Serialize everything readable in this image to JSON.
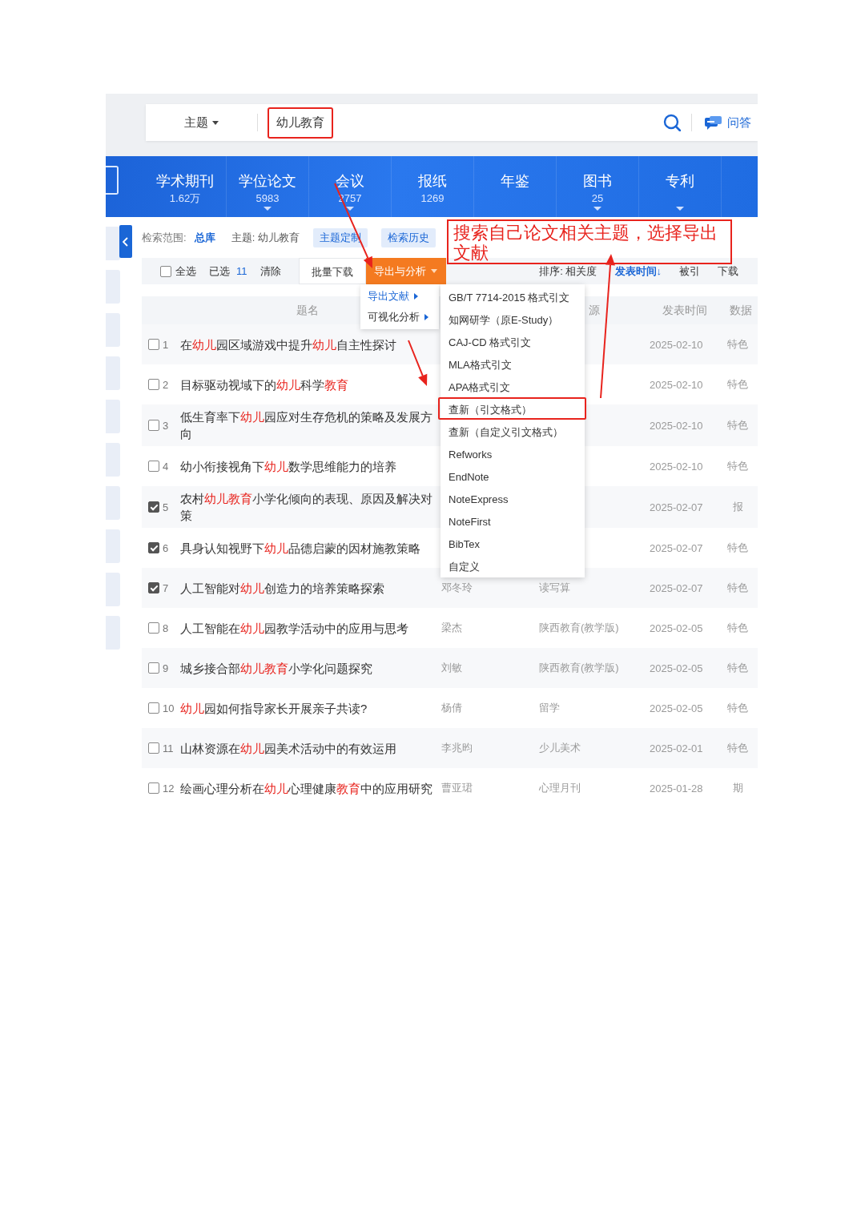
{
  "search": {
    "field_selector": "主题",
    "query": "幼儿教育",
    "query_marked": true,
    "qa_label": "问答"
  },
  "nav_tabs": [
    {
      "label": "学术期刊",
      "count": "1.62万",
      "expandable": false
    },
    {
      "label": "学位论文",
      "count": "5983",
      "expandable": true
    },
    {
      "label": "会议",
      "count": "2757",
      "expandable": true
    },
    {
      "label": "报纸",
      "count": "1269",
      "expandable": false
    },
    {
      "label": "年鉴",
      "expandable": false
    },
    {
      "label": "图书",
      "count": "25",
      "expandable": true
    },
    {
      "label": "专利",
      "expandable": true
    }
  ],
  "scope": {
    "label": "检索范围:",
    "value": "总库",
    "topic": "主题: 幼儿教育",
    "buttons": [
      "主题定制",
      "检索历史"
    ]
  },
  "toolbar": {
    "select_all": {
      "label": "全选",
      "checked": false
    },
    "selected_label": "已选",
    "selected_count": "11",
    "clear": "清除",
    "download": "批量下载",
    "export": "导出与分析",
    "sort_label": "排序: 相关度",
    "sort_options": [
      {
        "label": "发表时间↓",
        "selected": true
      },
      {
        "label": "被引",
        "selected": false
      },
      {
        "label": "下载",
        "selected": false
      }
    ]
  },
  "export_menu": [
    {
      "label": "导出文献",
      "selected": true
    },
    {
      "label": "可视化分析",
      "selected": false
    }
  ],
  "format_menu": [
    {
      "label": "GB/T 7714-2015 格式引文",
      "marked": false
    },
    {
      "label": "知网研学（原E-Study）",
      "marked": false
    },
    {
      "label": "CAJ-CD 格式引文",
      "marked": false
    },
    {
      "label": "MLA格式引文",
      "marked": false
    },
    {
      "label": "APA格式引文",
      "marked": false
    },
    {
      "label": "查新（引文格式）",
      "marked": true
    },
    {
      "label": "查新（自定义引文格式）",
      "marked": false
    },
    {
      "label": "Refworks",
      "marked": false
    },
    {
      "label": "EndNote",
      "marked": false
    },
    {
      "label": "NoteExpress",
      "marked": false
    },
    {
      "label": "NoteFirst",
      "marked": false
    },
    {
      "label": "BibTex",
      "marked": false
    },
    {
      "label": "自定义",
      "marked": false
    }
  ],
  "annotation": {
    "text": "搜索自己论文相关主题，选择导出文献"
  },
  "table": {
    "columns": [
      "题名",
      "源",
      "发表时间",
      "数据"
    ],
    "rows": [
      {
        "number": "1",
        "checked": false,
        "title": [
          {
            "text": "在",
            "highlight": false
          },
          {
            "text": "幼儿",
            "highlight": true
          },
          {
            "text": "园区域游戏中提升",
            "highlight": false
          },
          {
            "text": "幼儿",
            "highlight": true
          },
          {
            "text": "自主性探讨",
            "highlight": false
          }
        ],
        "date": "2025-02-10",
        "database": "特色"
      },
      {
        "number": "2",
        "checked": false,
        "title": [
          {
            "text": "目标驱动视域下的",
            "highlight": false
          },
          {
            "text": "幼儿",
            "highlight": true
          },
          {
            "text": "科学",
            "highlight": false
          },
          {
            "text": "教育",
            "highlight": true
          }
        ],
        "date": "2025-02-10",
        "database": "特色"
      },
      {
        "number": "3",
        "checked": false,
        "title": [
          {
            "text": "低生育率下",
            "highlight": false
          },
          {
            "text": "幼儿",
            "highlight": true
          },
          {
            "text": "园应对生存危机的策略及发展方向",
            "highlight": false
          }
        ],
        "date": "2025-02-10",
        "database": "特色"
      },
      {
        "number": "4",
        "checked": false,
        "title": [
          {
            "text": "幼小衔接视角下",
            "highlight": false
          },
          {
            "text": "幼儿",
            "highlight": true
          },
          {
            "text": "数学思维能力的培养",
            "highlight": false
          }
        ],
        "date": "2025-02-10",
        "database": "特色"
      },
      {
        "number": "5",
        "checked": true,
        "title": [
          {
            "text": "农村",
            "highlight": false
          },
          {
            "text": "幼儿教育",
            "highlight": true
          },
          {
            "text": "小学化倾向的表现、原因及解决对策",
            "highlight": false
          }
        ],
        "date": "2025-02-07",
        "database": "报"
      },
      {
        "number": "6",
        "checked": true,
        "title": [
          {
            "text": "具身认知视野下",
            "highlight": false
          },
          {
            "text": "幼儿",
            "highlight": true
          },
          {
            "text": "品德启蒙的因材施教策略",
            "highlight": false
          }
        ],
        "date": "2025-02-07",
        "database": "特色"
      },
      {
        "number": "7",
        "checked": true,
        "title": [
          {
            "text": "人工智能对",
            "highlight": false
          },
          {
            "text": "幼儿",
            "highlight": true
          },
          {
            "text": "创造力的培养策略探索",
            "highlight": false
          }
        ],
        "author": "邓冬玲",
        "source": "读写算",
        "date": "2025-02-07",
        "database": "特色"
      },
      {
        "number": "8",
        "checked": false,
        "title": [
          {
            "text": "人工智能在",
            "highlight": false
          },
          {
            "text": "幼儿",
            "highlight": true
          },
          {
            "text": "园教学活动中的应用与思考",
            "highlight": false
          }
        ],
        "author": "梁杰",
        "source": "陕西教育(教学版)",
        "date": "2025-02-05",
        "database": "特色"
      },
      {
        "number": "9",
        "checked": false,
        "title": [
          {
            "text": "城乡接合部",
            "highlight": false
          },
          {
            "text": "幼儿教育",
            "highlight": true
          },
          {
            "text": "小学化问题探究",
            "highlight": false
          }
        ],
        "author": "刘敏",
        "source": "陕西教育(教学版)",
        "date": "2025-02-05",
        "database": "特色"
      },
      {
        "number": "10",
        "checked": false,
        "title": [
          {
            "text": "幼儿",
            "highlight": true
          },
          {
            "text": "园如何指导家长开展亲子共读?",
            "highlight": false
          }
        ],
        "author": "杨倩",
        "source": "留学",
        "date": "2025-02-05",
        "database": "特色"
      },
      {
        "number": "11",
        "checked": false,
        "title": [
          {
            "text": "山林资源在",
            "highlight": false
          },
          {
            "text": "幼儿",
            "highlight": true
          },
          {
            "text": "园美术活动中的有效运用",
            "highlight": false
          }
        ],
        "author": "李兆昀",
        "source": "少儿美术",
        "date": "2025-02-01",
        "database": "特色"
      },
      {
        "number": "12",
        "checked": false,
        "title": [
          {
            "text": "绘画心理分析在",
            "highlight": false
          },
          {
            "text": "幼儿",
            "highlight": true
          },
          {
            "text": "心理健康",
            "highlight": false
          },
          {
            "text": "教育",
            "highlight": true
          },
          {
            "text": "中的应用研究",
            "highlight": false
          }
        ],
        "author": "曹亚珺",
        "source": "心理月刊",
        "date": "2025-01-28",
        "database": "期"
      }
    ]
  }
}
